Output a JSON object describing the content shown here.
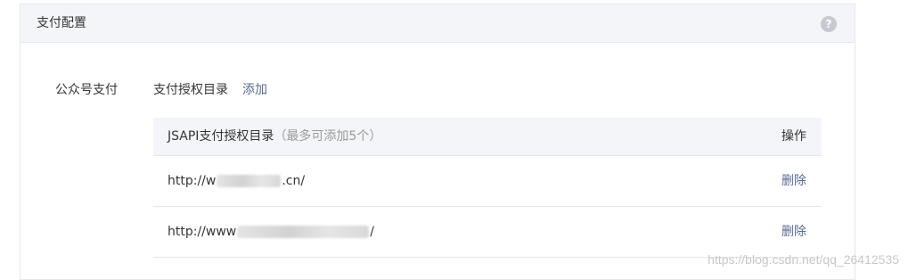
{
  "panel": {
    "title": "支付配置",
    "help_icon": "question-circle-icon"
  },
  "section": {
    "label": "公众号支付",
    "dir_title": "支付授权目录",
    "add_label": "添加"
  },
  "table": {
    "header_main": "JSAPI支付授权目录",
    "header_note": "（最多可添加5个）",
    "header_action": "操作",
    "rows": [
      {
        "url_prefix": "http://w",
        "url_suffix": ".cn/",
        "action": "删除"
      },
      {
        "url_prefix": "http://www",
        "url_suffix": "/",
        "action": "删除"
      }
    ]
  },
  "watermark": "https://blog.csdn.net/qq_26412535",
  "colors": {
    "link": "#576b95",
    "header_bg": "#f4f5f9",
    "border": "#e7e7eb"
  }
}
